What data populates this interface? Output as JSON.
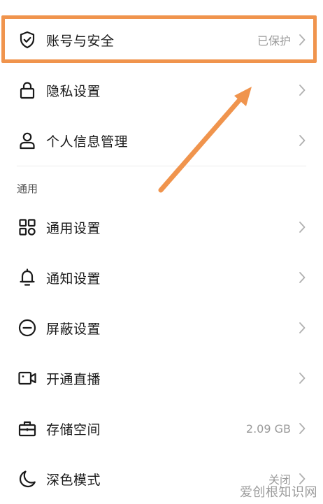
{
  "accent_color": "#f0944d",
  "section_title": "通用",
  "rows": [
    {
      "icon": "shield-check-icon",
      "label": "账号与安全",
      "value": "已保护"
    },
    {
      "icon": "lock-icon",
      "label": "隐私设置",
      "value": ""
    },
    {
      "icon": "person-icon",
      "label": "个人信息管理",
      "value": ""
    },
    {
      "icon": "grid-icon",
      "label": "通用设置",
      "value": ""
    },
    {
      "icon": "bell-icon",
      "label": "通知设置",
      "value": ""
    },
    {
      "icon": "block-icon",
      "label": "屏蔽设置",
      "value": ""
    },
    {
      "icon": "video-camera-icon",
      "label": "开通直播",
      "value": ""
    },
    {
      "icon": "toolbox-icon",
      "label": "存储空间",
      "value": "2.09 GB"
    },
    {
      "icon": "moon-icon",
      "label": "深色模式",
      "value": "关闭"
    }
  ],
  "watermark": "爱创根知识网"
}
